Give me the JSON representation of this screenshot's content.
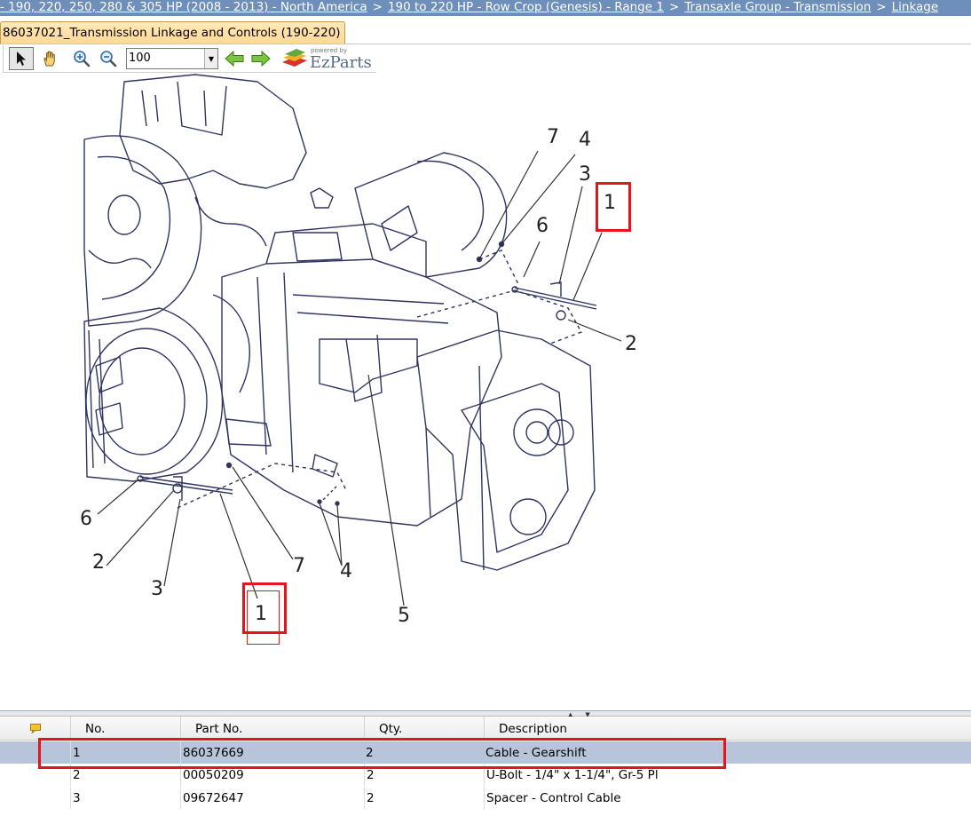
{
  "breadcrumb": {
    "items": [
      "- 190, 220, 250, 280 & 305 HP (2008 - 2013) - North America",
      "190 to 220 HP - Row Crop (Genesis) - Range 1",
      "Transaxle Group - Transmission",
      "Linkage"
    ],
    "separator": ">"
  },
  "tab": {
    "title": "86037021_Transmission Linkage and Controls (190-220)"
  },
  "toolbar": {
    "zoom_value": "100",
    "logo_powered": "powered by",
    "logo_brand": "EzParts"
  },
  "diagram": {
    "callouts": [
      "7",
      "4",
      "3",
      "1",
      "6",
      "2",
      "5",
      "6",
      "2",
      "3",
      "1",
      "7",
      "4"
    ]
  },
  "parts_table": {
    "columns": [
      "No.",
      "Part No.",
      "Qty.",
      "Description"
    ],
    "rows": [
      {
        "no": "1",
        "part_no": "86037669",
        "qty": "2",
        "description": "Cable - Gearshift",
        "selected": true
      },
      {
        "no": "2",
        "part_no": "00050209",
        "qty": "2",
        "description": "U-Bolt - 1/4\" x 1-1/4\", Gr-5 Pl",
        "selected": false
      },
      {
        "no": "3",
        "part_no": "09672647",
        "qty": "2",
        "description": "Spacer - Control Cable",
        "selected": false
      }
    ]
  },
  "colors": {
    "breadcrumb_bg": "#6d8fb9",
    "highlight": "#e8141b",
    "selected_row": "#b7c4d9",
    "tab_bg": "#ffd896"
  }
}
